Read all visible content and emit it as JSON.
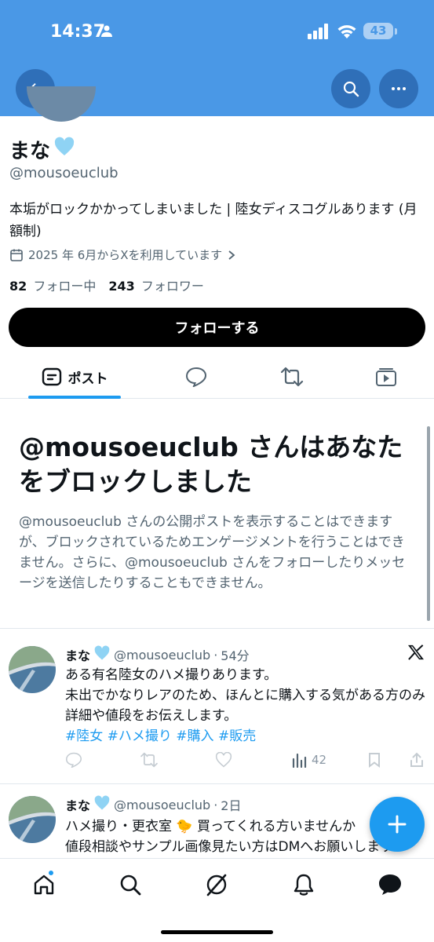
{
  "status_bar": {
    "time": "14:37",
    "battery": "43"
  },
  "profile": {
    "name": "まな",
    "handle": "@mousoeuclub",
    "bio": "本垢がロックかかってしまいました | 陸女ディスコグルあります (月額制)",
    "joined": "2025 年 6月からXを利用しています",
    "following_count": "82",
    "following_label": "フォロー中",
    "followers_count": "243",
    "followers_label": "フォロワー",
    "follow_button": "フォローする"
  },
  "tabs": {
    "posts": "ポスト"
  },
  "blocked": {
    "title": "@mousoeuclub さんはあなたをブロックしました",
    "text": "@mousoeuclub さんの公開ポストを表示することはできますが、ブロックされているためエンゲージメントを行うことはできません。さらに、@mousoeuclub さんをフォローしたりメッセージを送信したりすることもできません。"
  },
  "tweets": [
    {
      "name": "まな",
      "handle": "@mousoeuclub",
      "time": "54分",
      "line1": "ある有名陸女のハメ撮りあります。",
      "line2": "未出でかなりレアのため、ほんとに購入する気がある方のみ詳細や値段をお伝えします。",
      "hashtags": "#陸女 #ハメ撮り #購入 #販売",
      "views": "42"
    },
    {
      "name": "まな",
      "handle": "@mousoeuclub",
      "time": "2日",
      "line1": "ハメ撮り・更衣室 🐤 買ってくれる方いませんか",
      "line2": "値段相談やサンプル画像見たい方はDMへお願いします"
    }
  ],
  "colors": {
    "header": "#4a98e6",
    "accent": "#1d9bf0"
  }
}
